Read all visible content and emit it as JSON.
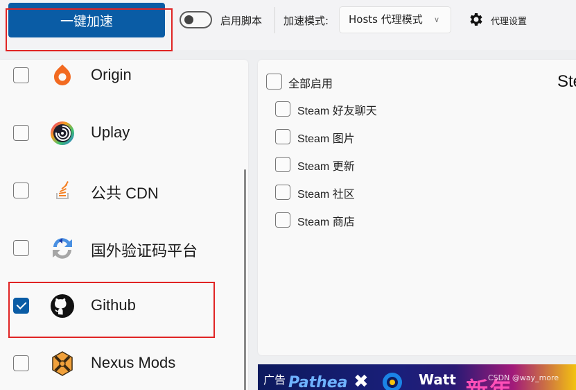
{
  "toolbar": {
    "accelerate_label": "一键加速",
    "script_toggle_label": "启用脚本",
    "script_toggle_on": false,
    "mode_label": "加速模式:",
    "mode_selected": "Hosts 代理模式",
    "proxy_settings_label": "代理设置"
  },
  "services": [
    {
      "label": "Origin",
      "checked": false,
      "icon": "origin-icon"
    },
    {
      "label": "Uplay",
      "checked": false,
      "icon": "uplay-icon"
    },
    {
      "label": "公共 CDN",
      "checked": false,
      "icon": "public-cdn-icon"
    },
    {
      "label": "国外验证码平台",
      "checked": false,
      "icon": "recaptcha-icon"
    },
    {
      "label": "Github",
      "checked": true,
      "icon": "github-icon"
    },
    {
      "label": "Nexus Mods",
      "checked": false,
      "icon": "nexus-mods-icon"
    }
  ],
  "detail": {
    "select_all_label": "全部启用",
    "title_partial": "Ste",
    "options": [
      {
        "label": "Steam 好友聊天",
        "checked": false
      },
      {
        "label": "Steam 图片",
        "checked": false
      },
      {
        "label": "Steam 更新",
        "checked": false
      },
      {
        "label": "Steam 社区",
        "checked": false
      },
      {
        "label": "Steam 商店",
        "checked": false
      }
    ]
  },
  "ad": {
    "tag": "广告",
    "brand1": "Pathea",
    "brand2": "Watt",
    "headline": "新年"
  },
  "watermark": "CSDN @way_more",
  "colors": {
    "accent": "#0a5ca5",
    "annotation": "#e02424"
  }
}
